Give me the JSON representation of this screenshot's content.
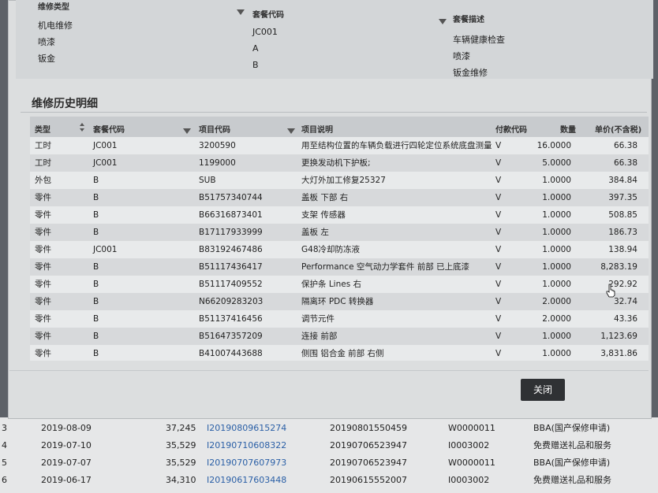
{
  "package_table": {
    "headers": {
      "type": "维修类型",
      "code": "套餐代码",
      "desc": "套餐描述"
    },
    "rows": [
      {
        "type": "机电维修",
        "code": "JC001",
        "desc": "车辆健康检查"
      },
      {
        "type": "喷漆",
        "code": "A",
        "desc": "喷漆"
      },
      {
        "type": "钣金",
        "code": "B",
        "desc": "钣金维修"
      }
    ]
  },
  "detail_section": {
    "title": "维修历史明细",
    "headers": {
      "type": "类型",
      "package_code": "套餐代码",
      "item_code": "项目代码",
      "item_desc": "项目说明",
      "payment_code": "付款代码",
      "qty": "数量",
      "unit_price": "单价(不含税)"
    },
    "rows": [
      {
        "type": "工时",
        "package_code": "JC001",
        "item_code": "3200590",
        "item_desc": "用至结构位置的车辆负载进行四轮定位系统底盘测量",
        "payment_code": "V",
        "qty": "16.0000",
        "unit_price": "66.38"
      },
      {
        "type": "工时",
        "package_code": "JC001",
        "item_code": "1199000",
        "item_desc": "更换发动机下护板;",
        "payment_code": "V",
        "qty": "5.0000",
        "unit_price": "66.38"
      },
      {
        "type": "外包",
        "package_code": "B",
        "item_code": "SUB",
        "item_desc": "大灯外加工修复25327",
        "payment_code": "V",
        "qty": "1.0000",
        "unit_price": "384.84"
      },
      {
        "type": "零件",
        "package_code": "B",
        "item_code": "B51757340744",
        "item_desc": "盖板 下部 右",
        "payment_code": "V",
        "qty": "1.0000",
        "unit_price": "397.35"
      },
      {
        "type": "零件",
        "package_code": "B",
        "item_code": "B66316873401",
        "item_desc": "支架 传感器",
        "payment_code": "V",
        "qty": "1.0000",
        "unit_price": "508.85"
      },
      {
        "type": "零件",
        "package_code": "B",
        "item_code": "B17117933999",
        "item_desc": "盖板 左",
        "payment_code": "V",
        "qty": "1.0000",
        "unit_price": "186.73"
      },
      {
        "type": "零件",
        "package_code": "JC001",
        "item_code": "B83192467486",
        "item_desc": "G48冷却防冻液",
        "payment_code": "V",
        "qty": "1.0000",
        "unit_price": "138.94"
      },
      {
        "type": "零件",
        "package_code": "B",
        "item_code": "B51117436417",
        "item_desc": "Performance 空气动力学套件 前部 已上底漆",
        "payment_code": "V",
        "qty": "1.0000",
        "unit_price": "8,283.19"
      },
      {
        "type": "零件",
        "package_code": "B",
        "item_code": "B51117409552",
        "item_desc": "保护条 Lines 右",
        "payment_code": "V",
        "qty": "1.0000",
        "unit_price": "292.92"
      },
      {
        "type": "零件",
        "package_code": "B",
        "item_code": "N66209283203",
        "item_desc": "隔离环 PDC 转换器",
        "payment_code": "V",
        "qty": "2.0000",
        "unit_price": "32.74"
      },
      {
        "type": "零件",
        "package_code": "B",
        "item_code": "B51137416456",
        "item_desc": "调节元件",
        "payment_code": "V",
        "qty": "2.0000",
        "unit_price": "43.36"
      },
      {
        "type": "零件",
        "package_code": "B",
        "item_code": "B51647357209",
        "item_desc": "连接 前部",
        "payment_code": "V",
        "qty": "1.0000",
        "unit_price": "1,123.69"
      },
      {
        "type": "零件",
        "package_code": "B",
        "item_code": "B41007443688",
        "item_desc": "侧围 铝合金 前部 右侧",
        "payment_code": "V",
        "qty": "1.0000",
        "unit_price": "3,831.86"
      }
    ]
  },
  "close_button": "关闭",
  "background_list": [
    {
      "idx": "3",
      "date": "2019-08-09",
      "mileage": "37,245",
      "order": "I20190809615274",
      "ref": "20190801550459",
      "code": "W0000011",
      "desc": "BBA(国产保修申请)"
    },
    {
      "idx": "4",
      "date": "2019-07-10",
      "mileage": "35,529",
      "order": "I20190710608322",
      "ref": "20190706523947",
      "code": "I0003002",
      "desc": "免费赠送礼品和服务"
    },
    {
      "idx": "5",
      "date": "2019-07-07",
      "mileage": "35,529",
      "order": "I20190707607973",
      "ref": "20190706523947",
      "code": "W0000011",
      "desc": "BBA(国产保修申请)"
    },
    {
      "idx": "6",
      "date": "2019-06-17",
      "mileage": "34,310",
      "order": "I20190617603448",
      "ref": "20190615552007",
      "code": "I0003002",
      "desc": "免费赠送礼品和服务"
    }
  ]
}
